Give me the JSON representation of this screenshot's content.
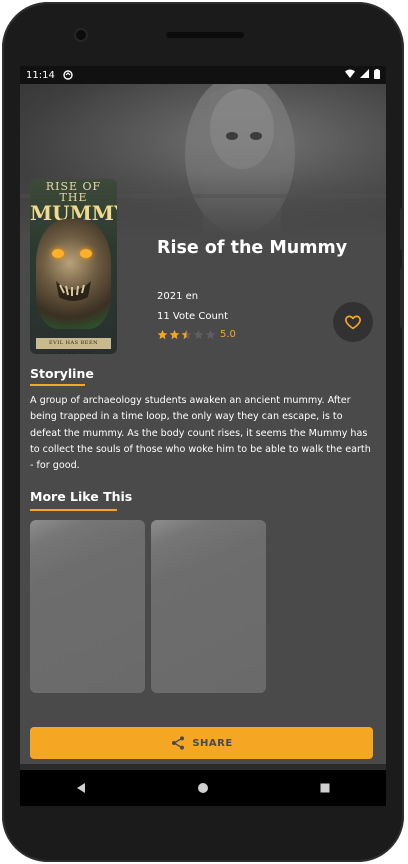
{
  "status_bar": {
    "time": "11:14",
    "icons": [
      "sync-icon",
      "wifi-icon",
      "signal-icon",
      "battery-icon"
    ]
  },
  "movie": {
    "title": "Rise of the Mummy",
    "year_lang": "2021 en",
    "vote_count": "11 Vote Count",
    "rating": "5.0",
    "stars": {
      "filled": 2,
      "half": 1,
      "empty": 2
    },
    "poster": {
      "title_line1": "RISE OF THE",
      "title_line2": "MUMMY",
      "tagline": "EVIL HAS BEEN UNEARTHED"
    }
  },
  "storyline": {
    "heading": "Storyline",
    "text": "A group of archaeology students awaken an ancient mummy. After being trapped in a time loop, the only way they can escape, is to defeat the mummy. As the body count rises, it seems the Mummy has to collect the souls of those who woke him to be able to walk the earth - for good."
  },
  "more_like_this": {
    "heading": "More Like This",
    "cards": [
      {
        "label": ""
      },
      {
        "label": ""
      }
    ]
  },
  "share": {
    "label": "SHARE"
  },
  "colors": {
    "accent": "#f5a623",
    "background": "#4a4a4a",
    "fav_bg": "#323232"
  },
  "icons": {
    "favorite": "heart-icon",
    "share": "share-icon"
  },
  "nav": [
    "back-icon",
    "home-icon",
    "recents-icon"
  ]
}
